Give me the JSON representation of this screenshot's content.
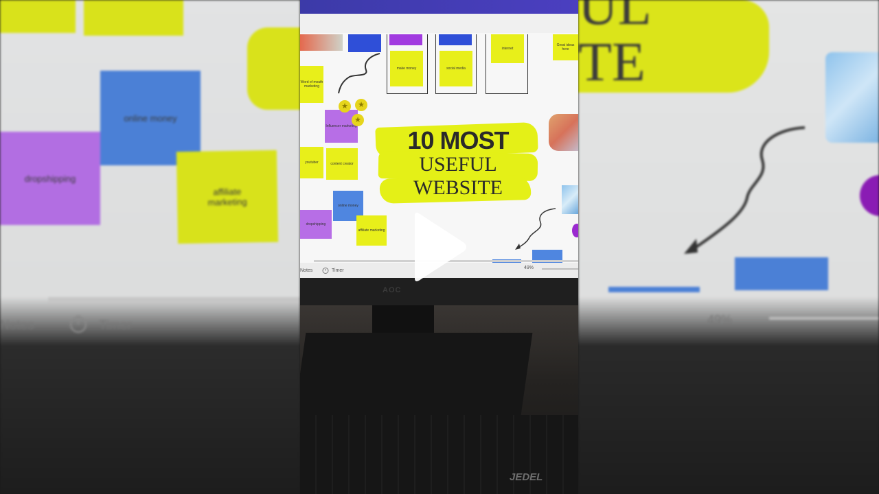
{
  "slide": {
    "title_line1": "10 MOST",
    "title_line2": "USEFUL",
    "title_line3": "WEBSITE"
  },
  "canvas_notes": {
    "make_money": "make money",
    "social_media": "social media",
    "internet": "internet",
    "great_ideas": "Great ideas here",
    "word_of_mouth": "Word of mouth marketing",
    "influencer": "Influencer marketing",
    "youtuber": "youtuber",
    "content_creator": "content creator",
    "online_money": "online money",
    "dropshipping": "dropshipping",
    "affiliate": "affiliate marketing"
  },
  "footer": {
    "notes_label": "Notes",
    "timer_label": "Timer",
    "zoom": "49%"
  },
  "side_left": {
    "online_money": "online money",
    "dropshipping": "dropshipping",
    "affiliate": "affiliate marketing",
    "notes_label": "Notes",
    "timer_label": "Timer"
  },
  "side_right": {
    "title_fragment_1": "UL",
    "title_fragment_2": "TE",
    "zoom": "49%"
  },
  "monitor_brand": "AOC",
  "keyboard_brand": "JEDEL",
  "colors": {
    "highlight": "#e4f017",
    "note_yellow": "#e8ef1a",
    "note_blue": "#4f86e0",
    "note_purple": "#b76ee6",
    "topbar": "#3c3aa8"
  },
  "icons": [
    "play-icon",
    "timer-icon",
    "star-icon",
    "arrow-doodle-icon"
  ]
}
